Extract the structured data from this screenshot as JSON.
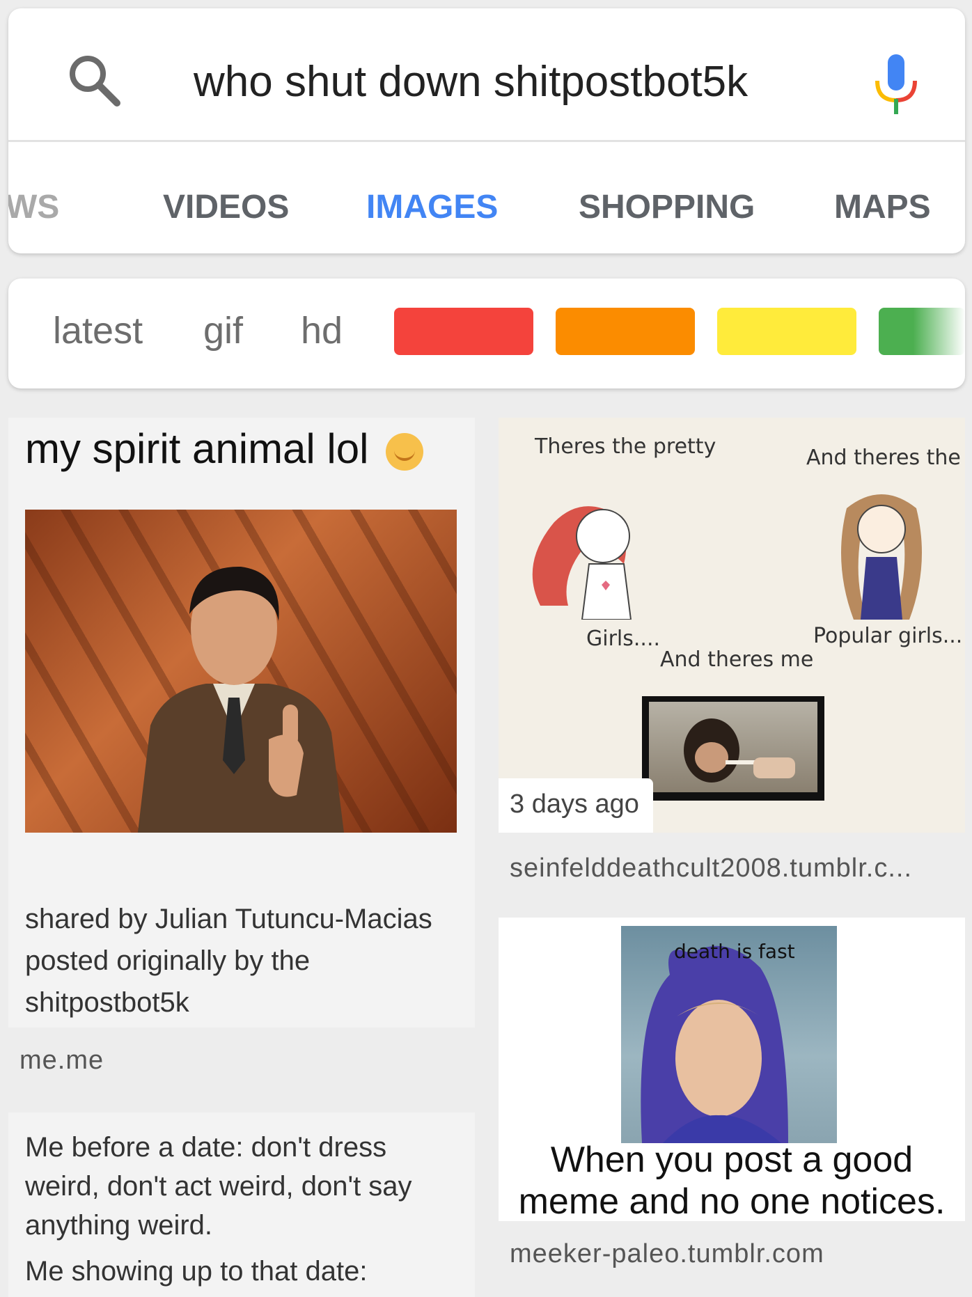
{
  "search": {
    "query": "who shut down shitpostbot5k"
  },
  "tabs": [
    {
      "label": "WS"
    },
    {
      "label": "VIDEOS"
    },
    {
      "label": "IMAGES"
    },
    {
      "label": "SHOPPING"
    },
    {
      "label": "MAPS"
    }
  ],
  "active_tab": "IMAGES",
  "filters": {
    "chips": [
      "latest",
      "gif",
      "hd"
    ],
    "colors": [
      "#f4433c",
      "#fb8c00",
      "#ffeb3b",
      "#4caf50"
    ]
  },
  "results": [
    {
      "caption": "my spirit animal lol",
      "body": "shared by Julian Tutuncu-Macias posted originally by the shitpostbot5k",
      "source": "me.me"
    },
    {
      "comic": {
        "t1": "Theres the pretty",
        "t2": "And theres the",
        "t3": "Girls....",
        "t4": "Popular girls...",
        "t5": "And theres me"
      },
      "timestamp": "3 days ago",
      "source": "seinfelddeathcult2008.tumblr.c..."
    },
    {
      "photo_text": "death is fast",
      "caption": "When you post a good meme and no one notices.",
      "source": "meeker-paleo.tumblr.com"
    },
    {
      "text": "Me before a date: don't dress weird, don't act weird, don't say anything weird.",
      "text2": "Me showing up to that date:"
    }
  ],
  "colors": {
    "accent": "#4285f4",
    "tab_inactive": "#5f6368"
  }
}
